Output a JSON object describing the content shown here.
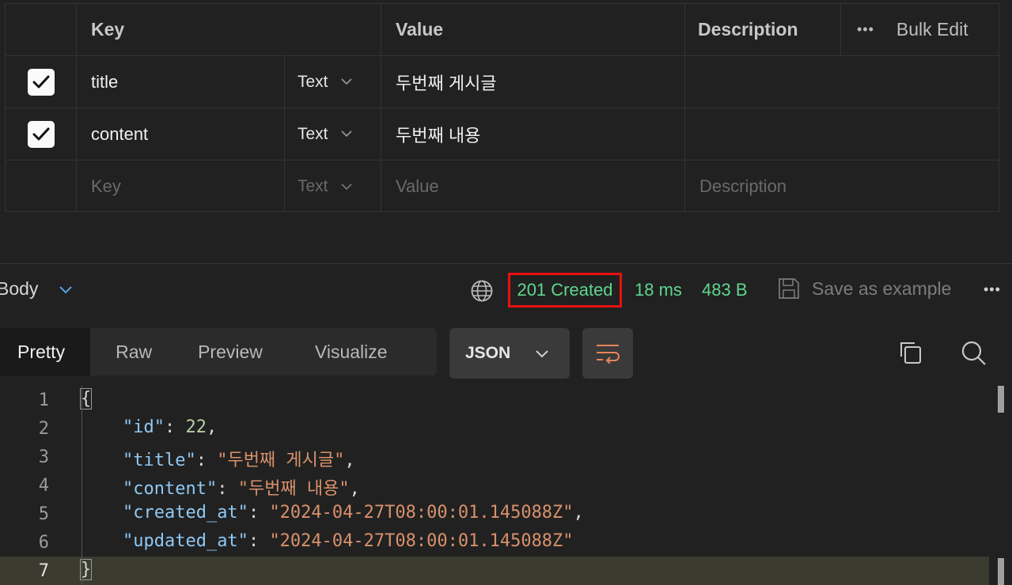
{
  "table": {
    "headers": {
      "key": "Key",
      "value": "Value",
      "description": "Description"
    },
    "more_icon": "•••",
    "bulk_edit": "Bulk Edit",
    "rows": [
      {
        "checked": true,
        "key": "title",
        "type": "Text",
        "value": "두번째 게시글",
        "description": ""
      },
      {
        "checked": true,
        "key": "content",
        "type": "Text",
        "value": "두번째 내용",
        "description": ""
      }
    ],
    "new_row": {
      "key_placeholder": "Key",
      "type": "Text",
      "value_placeholder": "Value",
      "description_placeholder": "Description"
    }
  },
  "response": {
    "body_label": "Body",
    "status": "201 Created",
    "time": "18 ms",
    "size": "483 B",
    "save_example": "Save as example",
    "more_icon": "•••",
    "status_color": "#5fd68f",
    "highlight_color": "#e8110e"
  },
  "tabs": [
    "Pretty",
    "Raw",
    "Preview",
    "Visualize"
  ],
  "format": {
    "selected": "JSON"
  },
  "code": {
    "line_numbers": [
      "1",
      "2",
      "3",
      "4",
      "5",
      "6",
      "7"
    ],
    "open_brace": "{",
    "close_brace": "}",
    "fields": [
      {
        "key": "\"id\"",
        "value": "22"
      },
      {
        "key": "\"title\"",
        "value": "\"두번째 게시글\""
      },
      {
        "key": "\"content\"",
        "value": "\"두번째 내용\""
      },
      {
        "key": "\"created_at\"",
        "value": "\"2024-04-27T08:00:01.145088Z\""
      },
      {
        "key": "\"updated_at\"",
        "value": "\"2024-04-27T08:00:01.145088Z\""
      }
    ]
  }
}
